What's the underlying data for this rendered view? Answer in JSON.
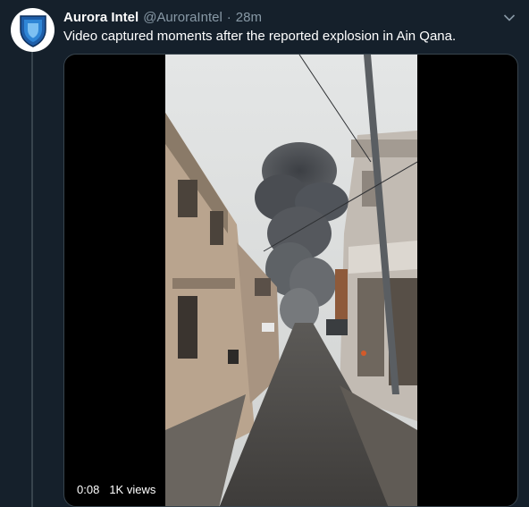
{
  "tweet": {
    "display_name": "Aurora Intel",
    "handle": "@AuroraIntel",
    "separator": "·",
    "time": "28m",
    "text": "Video captured moments after the reported explosion in Ain Qana.",
    "avatar_icon": "shield-logo-icon",
    "menu_icon": "chevron-down-icon"
  },
  "video": {
    "duration": "0:08",
    "views": "1K views"
  },
  "colors": {
    "background": "#15202b",
    "secondary_text": "#8899a6",
    "border": "#38444d",
    "logo_blue": "#1f5ea8"
  }
}
